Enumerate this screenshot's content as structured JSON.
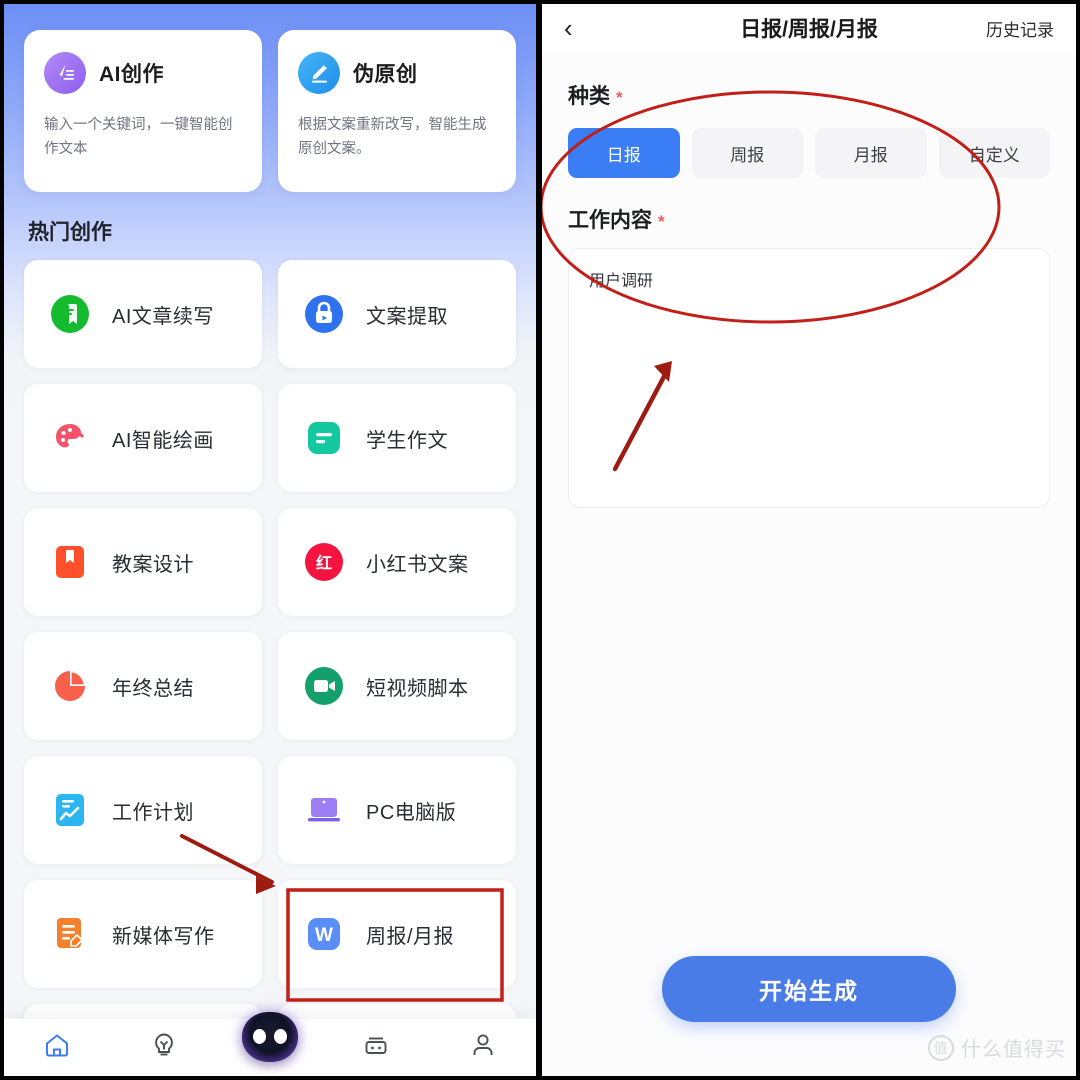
{
  "left_screen": {
    "feature_cards": [
      {
        "title": "AI创作",
        "desc": "输入一个关键词，一键智能创作文本",
        "icon": "pen-lines-icon",
        "color": "#9b6ef0"
      },
      {
        "title": "伪原创",
        "desc": "根据文案重新改写，智能生成原创文案。",
        "icon": "pencil-icon",
        "color": "#2196f3"
      }
    ],
    "section_title": "热门创作",
    "tools": [
      {
        "label": "AI文章续写",
        "icon": "green-doc-icon",
        "color": "#15bb2e"
      },
      {
        "label": "文案提取",
        "icon": "blue-extract-icon",
        "color": "#2f72ef"
      },
      {
        "label": "AI智能绘画",
        "icon": "palette-icon",
        "color": "#f4536a"
      },
      {
        "label": "学生作文",
        "icon": "teal-note-icon",
        "color": "#14c8a0"
      },
      {
        "label": "教案设计",
        "icon": "bookmark-icon",
        "color": "#ff4f2b"
      },
      {
        "label": "小红书文案",
        "icon": "xiaohongshu-icon",
        "color": "#f4143f",
        "glyph": "红"
      },
      {
        "label": "年终总结",
        "icon": "pie-chart-icon",
        "color": "#f9604b"
      },
      {
        "label": "短视频脚本",
        "icon": "video-camera-icon",
        "color": "#14a06b"
      },
      {
        "label": "工作计划",
        "icon": "chart-doc-icon",
        "color": "#2cb6f0"
      },
      {
        "label": "PC电脑版",
        "icon": "laptop-icon",
        "color": "#9b7ef5"
      },
      {
        "label": "新媒体写作",
        "icon": "orange-edit-doc-icon",
        "color": "#f4802b"
      },
      {
        "label": "周报/月报",
        "icon": "w-word-icon",
        "color": "#5b8df6",
        "glyph": "W",
        "highlighted": true
      }
    ],
    "tabbar": [
      {
        "name": "home-icon",
        "active": true
      },
      {
        "name": "bulb-icon",
        "active": false
      },
      {
        "name": "ai-robot-avatar-icon",
        "active": false
      },
      {
        "name": "robot-box-icon",
        "active": false
      },
      {
        "name": "profile-icon",
        "active": false
      }
    ]
  },
  "right_screen": {
    "nav": {
      "back_glyph": "‹",
      "title": "日报/周报/月报",
      "history_label": "历史记录"
    },
    "kind_field": {
      "label": "种类",
      "required_mark": "*",
      "options": [
        "日报",
        "周报",
        "月报",
        "自定义"
      ],
      "selected": "日报"
    },
    "content_field": {
      "label": "工作内容",
      "required_mark": "*",
      "value": "用户调研",
      "placeholder": "用户调研"
    },
    "cta_label": "开始生成"
  },
  "watermark": {
    "badge": "值",
    "text": "什么值得买"
  },
  "annotation": {
    "accent": "#c21f18",
    "ellipse_target": "种类与工作内容区域",
    "arrow_to_textarea": true,
    "arrow_to_weekly_card": true,
    "highlight_box": "周报/月报"
  }
}
